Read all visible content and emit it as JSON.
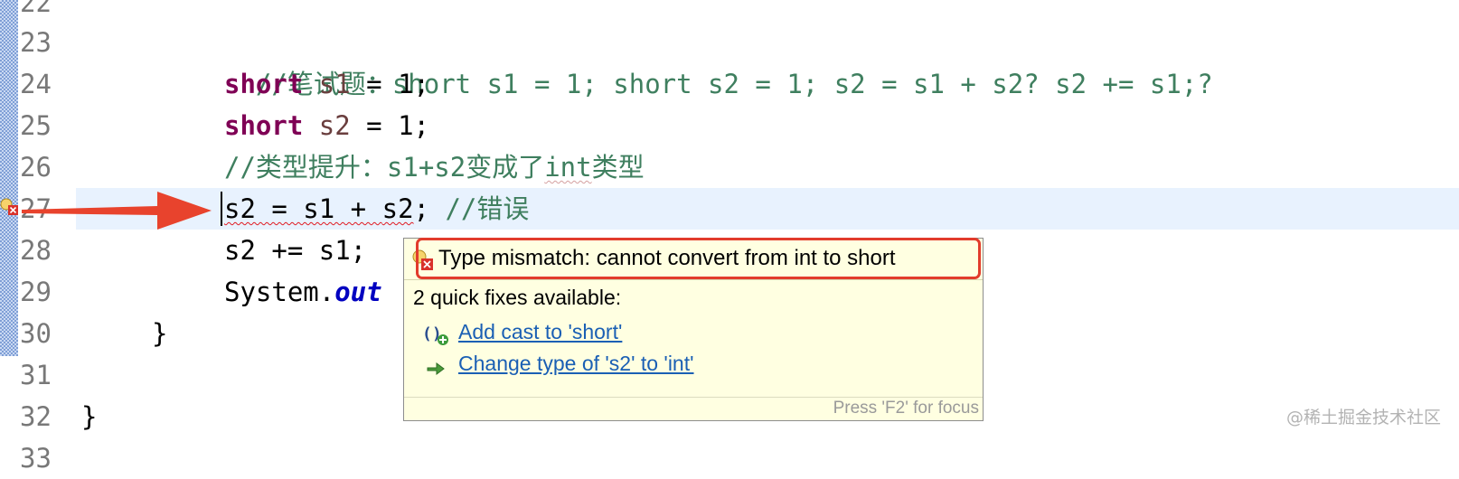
{
  "editor": {
    "line_numbers": [
      "22",
      "23",
      "24",
      "25",
      "26",
      "27",
      "28",
      "29",
      "30",
      "31",
      "32",
      "33"
    ],
    "lines": {
      "l23_comment": "//笔试题：short s1 = 1; short s2 = 1; s2 = s1 + s2? s2 += s1;?",
      "l24_kw": "short",
      "l24_var": "s1",
      "l24_rest": " = 1;",
      "l25_kw": "short",
      "l25_var": "s2",
      "l25_rest": " = 1;",
      "l26_comment_a": "//类型提升：s1+s2变成了",
      "l26_comment_int": "int",
      "l26_comment_b": "类型",
      "l27_a": "s2 = s1 + ",
      "l27_b": "s2",
      "l27_c": "; ",
      "l27_comment": "//错误",
      "l28": "s2 += s1;",
      "l29_a": "System.",
      "l29_field": "out",
      "l30": "}",
      "l32": "}"
    }
  },
  "popup": {
    "title": "Type mismatch: cannot convert from int to short",
    "quick_fix_count": "2 quick fixes available:",
    "fixes": [
      {
        "label": "Add cast to 'short'",
        "icon": "add-cast-icon"
      },
      {
        "label": "Change type of 's2' to 'int'",
        "icon": "change-type-icon"
      }
    ],
    "focus_hint": "Press 'F2' for focus"
  },
  "watermark": "@稀土掘金技术社区",
  "colors": {
    "keyword": "#7f0055",
    "comment": "#3f7f5f",
    "variable": "#6a3e3e",
    "field": "#0000c0",
    "current_line": "#e8f2fe",
    "popup_bg": "#ffffe1",
    "highlight": "#e23c2c",
    "link": "#1a5fb4"
  }
}
